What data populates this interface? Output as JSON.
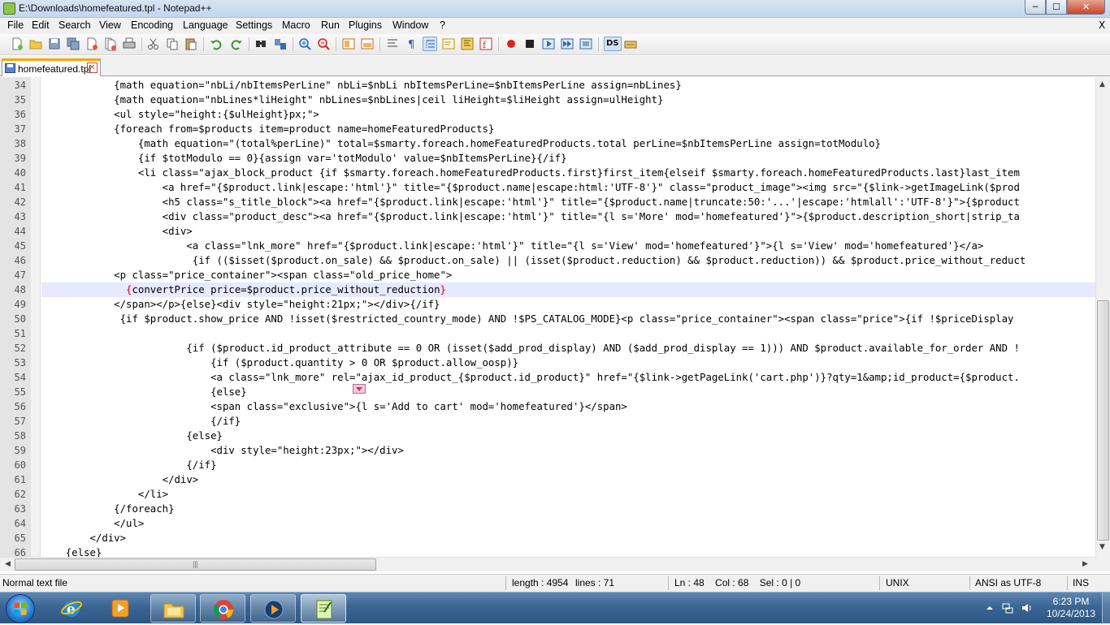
{
  "window": {
    "title": "E:\\Downloads\\homefeatured.tpl - Notepad++",
    "min_label": "─",
    "max_label": "☐",
    "close_label": "✕"
  },
  "menu": {
    "items": [
      "File",
      "Edit",
      "Search",
      "View",
      "Encoding",
      "Language",
      "Settings",
      "Macro",
      "Run",
      "Plugins",
      "Window",
      "?"
    ],
    "close_label": "X"
  },
  "toolbar": {
    "icons": [
      "new-file-icon",
      "open-file-icon",
      "save-icon",
      "save-all-icon",
      "close-icon",
      "close-all-icon",
      "print-icon",
      "cut-icon",
      "copy-icon",
      "paste-icon",
      "undo-icon",
      "redo-icon",
      "find-icon",
      "replace-icon",
      "zoom-in-icon",
      "zoom-out-icon",
      "sync-vertical-icon",
      "sync-horizontal-icon",
      "word-wrap-icon",
      "show-all-chars-icon",
      "indent-guide-icon",
      "user-language-icon",
      "document-map-icon",
      "function-list-icon",
      "record-macro-icon",
      "stop-record-icon",
      "playback-macro-icon",
      "run-macro-multiple-icon",
      "save-macro-icon",
      "ds-plugin-icon",
      "spell-check-icon"
    ],
    "ds_label": "DS"
  },
  "tabs": [
    {
      "label": "homefeatured.tpl",
      "active": true
    }
  ],
  "editor": {
    "current_line": 48,
    "lines": [
      {
        "n": "34",
        "text": "            {math equation=\"nbLi/nbItemsPerLine\" nbLi=$nbLi nbItemsPerLine=$nbItemsPerLine assign=nbLines}"
      },
      {
        "n": "35",
        "text": "            {math equation=\"nbLines*liHeight\" nbLines=$nbLines|ceil liHeight=$liHeight assign=ulHeight}"
      },
      {
        "n": "36",
        "text": "            <ul style=\"height:{$ulHeight}px;\">"
      },
      {
        "n": "37",
        "text": "            {foreach from=$products item=product name=homeFeaturedProducts}"
      },
      {
        "n": "38",
        "text": "                {math equation=\"(total%perLine)\" total=$smarty.foreach.homeFeaturedProducts.total perLine=$nbItemsPerLine assign=totModulo}"
      },
      {
        "n": "39",
        "text": "                {if $totModulo == 0}{assign var='totModulo' value=$nbItemsPerLine}{/if}"
      },
      {
        "n": "40",
        "text": "                <li class=\"ajax_block_product {if $smarty.foreach.homeFeaturedProducts.first}first_item{elseif $smarty.foreach.homeFeaturedProducts.last}last_item"
      },
      {
        "n": "41",
        "text": "                    <a href=\"{$product.link|escape:'html'}\" title=\"{$product.name|escape:html:'UTF-8'}\" class=\"product_image\"><img src=\"{$link->getImageLink($prod"
      },
      {
        "n": "42",
        "text": "                    <h5 class=\"s_title_block\"><a href=\"{$product.link|escape:'html'}\" title=\"{$product.name|truncate:50:'...'|escape:'htmlall':'UTF-8'}\">{$product"
      },
      {
        "n": "43",
        "text": "                    <div class=\"product_desc\"><a href=\"{$product.link|escape:'html'}\" title=\"{l s='More' mod='homefeatured'}\">{$product.description_short|strip_ta"
      },
      {
        "n": "44",
        "text": "                    <div>"
      },
      {
        "n": "45",
        "text": "                        <a class=\"lnk_more\" href=\"{$product.link|escape:'html'}\" title=\"{l s='View' mod='homefeatured'}\">{l s='View' mod='homefeatured'}</a>"
      },
      {
        "n": "46",
        "text": "                         {if (($isset($product.on_sale) && $product.on_sale) || (isset($product.reduction) && $product.reduction)) && $product.price_without_reduct"
      },
      {
        "n": "47",
        "text": "            <p class=\"price_container\"><span class=\"old_price_home\">"
      },
      {
        "n": "48",
        "text": "              {convertPrice price=$product.price_without_reduction}"
      },
      {
        "n": "49",
        "text": "            </span></p>{else}<div style=\"height:21px;\"></div>{/if}"
      },
      {
        "n": "50",
        "text": "             {if $product.show_price AND !isset($restricted_country_mode) AND !$PS_CATALOG_MODE}<p class=\"price_container\"><span class=\"price\">{if !$priceDisplay"
      },
      {
        "n": "51",
        "text": ""
      },
      {
        "n": "52",
        "text": "                        {if ($product.id_product_attribute == 0 OR (isset($add_prod_display) AND ($add_prod_display == 1))) AND $product.available_for_order AND !"
      },
      {
        "n": "53",
        "text": "                            {if ($product.quantity > 0 OR $product.allow_oosp)}"
      },
      {
        "n": "54",
        "text": "                            <a class=\"lnk_more\" rel=\"ajax_id_product_{$product.id_product}\" href=\"{$link->getPageLink('cart.php')}?qty=1&amp;id_product={$product."
      },
      {
        "n": "55",
        "text": "                            {else}"
      },
      {
        "n": "56",
        "text": "                            <span class=\"exclusive\">{l s='Add to cart' mod='homefeatured'}</span>"
      },
      {
        "n": "57",
        "text": "                            {/if}"
      },
      {
        "n": "58",
        "text": "                        {else}"
      },
      {
        "n": "59",
        "text": "                            <div style=\"height:23px;\"></div>"
      },
      {
        "n": "60",
        "text": "                        {/if}"
      },
      {
        "n": "61",
        "text": "                    </div>"
      },
      {
        "n": "62",
        "text": "                </li>"
      },
      {
        "n": "63",
        "text": "            {/foreach}"
      },
      {
        "n": "64",
        "text": "            </ul>"
      },
      {
        "n": "65",
        "text": "        </div>"
      },
      {
        "n": "66",
        "text": "    {else}"
      }
    ]
  },
  "statusbar": {
    "file_type": "Normal text file",
    "length": "length : 4954",
    "lines": "lines : 71",
    "position": "Ln : 48    Col : 68    Sel : 0 | 0",
    "eol": "UNIX",
    "encoding": "ANSI as UTF-8",
    "mode": "INS"
  },
  "taskbar": {
    "apps": [
      "internet-explorer-icon",
      "media-player-icon",
      "file-explorer-icon",
      "chrome-icon",
      "media-center-icon",
      "notepad-plus-plus-icon"
    ],
    "time": "6:23 PM",
    "date": "10/24/2013"
  },
  "colors": {
    "current_line_bg": "#e8e8ff",
    "gutter_bg": "#e4e4e4",
    "brace_highlight": "#e00000",
    "active_tab_accent": "#f7a600"
  }
}
